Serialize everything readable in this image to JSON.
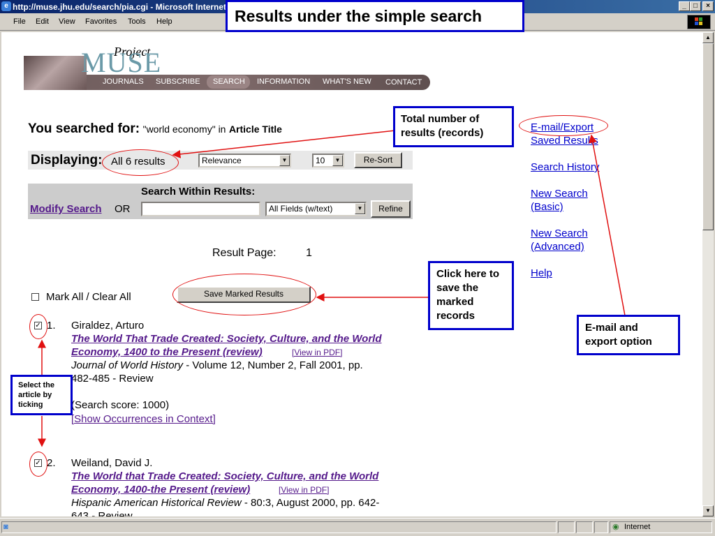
{
  "window": {
    "title": "http://muse.jhu.edu/search/pia.cgi - Microsoft Internet Explorer",
    "ie_icon": "e",
    "controls": {
      "minimize": "_",
      "maximize": "□",
      "close": "×"
    }
  },
  "menubar": [
    "File",
    "Edit",
    "View",
    "Favorites",
    "Tools",
    "Help"
  ],
  "status": {
    "zone": "Internet"
  },
  "header_callout": "Results under the simple search",
  "site": {
    "logo_small": "Project",
    "logo_big": "MUSE",
    "nav": [
      "JOURNALS",
      "SUBSCRIBE",
      "SEARCH",
      "INFORMATION",
      "WHAT'S NEW",
      "CONTACT"
    ]
  },
  "search_summary": {
    "prefix": "You searched for:",
    "query": "\"world economy\" in",
    "field": "Article Title"
  },
  "display": {
    "label": "Displaying:",
    "count": "All 6 results",
    "sort_value": "Relevance",
    "per_page_value": "10",
    "resort_label": "Re-Sort"
  },
  "within": {
    "heading": "Search Within Results:",
    "modify_label": "Modify Search",
    "or_label": "OR",
    "input_value": "",
    "field_value": "All Fields (w/text)",
    "refine_label": "Refine"
  },
  "pager": {
    "label": "Result Page:",
    "page": "1"
  },
  "mark_all_label": "Mark All / Clear All",
  "save_marked_label": "Save Marked Results",
  "results": [
    {
      "num": "1.",
      "author": "Giraldez, Arturo",
      "title_line1": "The World That Trade Created: Society, Culture, and the World",
      "title_line2": "Economy, 1400 to the Present (review)",
      "pdf": "[View in PDF]",
      "journal": "Journal of World History",
      "details_line1": " - Volume 12, Number 2, Fall 2001, pp.",
      "details_line2": "482-485 - Review",
      "score": "(Search score: 1000)",
      "occurrences": "[Show Occurrences in Context]",
      "checked": true
    },
    {
      "num": "2.",
      "author": "Weiland, David J.",
      "title_line1": "The World that Trade Created: Society, Culture, and the World",
      "title_line2": "Economy, 1400-the Present (review)",
      "pdf": "[View in PDF]",
      "journal": "Hispanic American Historical Review",
      "details_line1": " - 80:3, August 2000, pp. 642-",
      "details_line2": "643 - Review",
      "checked": true
    }
  ],
  "sidebar": {
    "email_export_1": "E-mail/Export",
    "email_export_2": "Saved Results",
    "history": "Search History",
    "basic_1": "New Search",
    "basic_2": "(Basic)",
    "advanced_1": "New Search",
    "advanced_2": "(Advanced)",
    "help": "Help"
  },
  "callouts": {
    "total": "Total number of results (records)",
    "save": "Click here to save the marked records",
    "email": "E-mail and export option",
    "select": "Select the article by ticking"
  },
  "colors": {
    "annotation_red": "#e01010",
    "annotation_blue": "#0000cc",
    "link_visited": "#551a8b"
  }
}
